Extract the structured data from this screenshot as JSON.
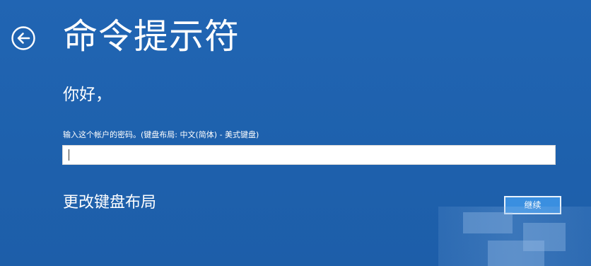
{
  "header": {
    "title": "命令提示符",
    "back_icon": "back-arrow-circle-icon"
  },
  "main": {
    "greeting": "你好，",
    "password_label": "输入这个帐户的密码。(键盘布局: 中文(简体) - 美式键盘)",
    "password_value": "",
    "change_layout_label": "更改键盘布局",
    "continue_label": "继续"
  },
  "colors": {
    "background": "#1f5fae",
    "accent_button": "#3a8fe0",
    "text": "#ffffff"
  }
}
